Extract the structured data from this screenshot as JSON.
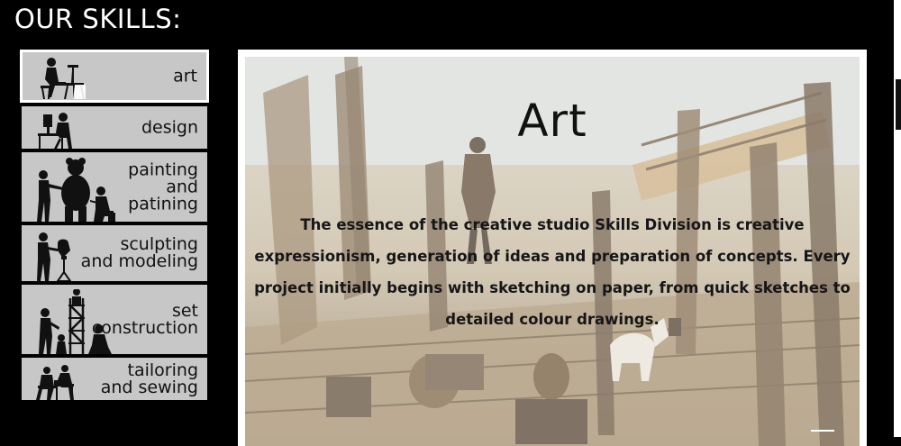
{
  "page": {
    "title": "OUR SKILLS:"
  },
  "sidebar": {
    "items": [
      {
        "label": "art",
        "icon": "artist-at-easel-icon",
        "active": true
      },
      {
        "label": "design",
        "icon": "designer-at-computer-icon",
        "active": false
      },
      {
        "label": "painting\nand\npatining",
        "icon": "painters-with-bear-figure-icon",
        "active": false
      },
      {
        "label": "sculpting\nand modeling",
        "icon": "sculptor-at-stand-icon",
        "active": false
      },
      {
        "label": "set\nconstruction",
        "icon": "builders-on-scaffold-icon",
        "active": false
      },
      {
        "label": "tailoring\nand sewing",
        "icon": "tailor-at-sewing-machine-icon",
        "active": false
      }
    ]
  },
  "panel": {
    "heading": "Art",
    "description": "The essence of the creative studio Skills Division is creative expressionism, generation of ideas and preparation of concepts. Every project initially begins with sketching on paper, from quick sketches to detailed colour drawings.",
    "background_image": "ship-deck-concept-sketch"
  },
  "colors": {
    "page_background": "#000000",
    "sidebar_item_background": "#c7c7c7",
    "text_light": "#ffffff",
    "text_dark": "#111111"
  }
}
